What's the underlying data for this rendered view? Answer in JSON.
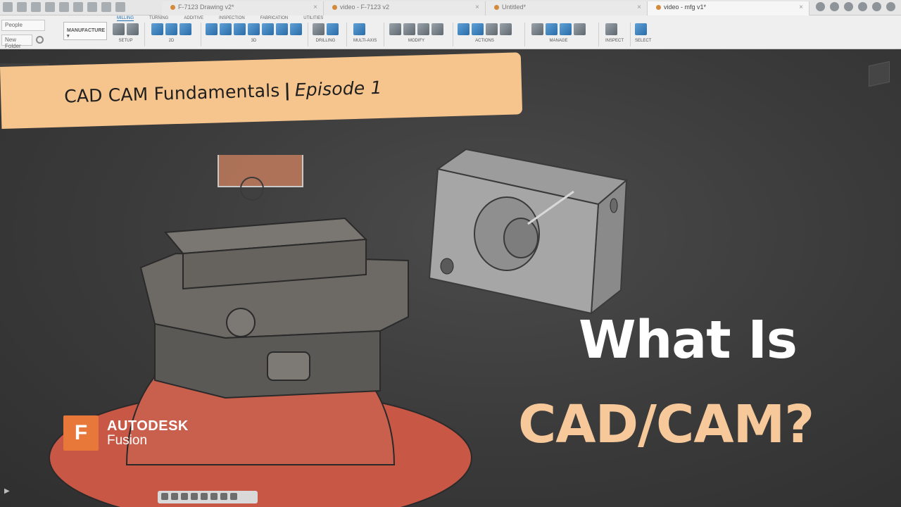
{
  "app": {
    "tabs": [
      {
        "label": "F-7123 Drawing v2*",
        "active": false
      },
      {
        "label": "video - F-7123 v2",
        "active": false
      },
      {
        "label": "Untitled*",
        "active": false
      },
      {
        "label": "video - mfg v1*",
        "active": true
      }
    ],
    "people_label": "People",
    "new_folder_label": "New Folder",
    "workspace_label": "MANUFACTURE",
    "subtabs": [
      "MILLING",
      "TURNING",
      "ADDITIVE",
      "INSPECTION",
      "FABRICATION",
      "UTILITIES"
    ],
    "groups": [
      "SETUP",
      "2D",
      "3D",
      "DRILLING",
      "MULTI-AXIS",
      "MODIFY",
      "ACTIONS",
      "MANAGE",
      "INSPECT",
      "SELECT"
    ]
  },
  "banner": {
    "series": "CAD CAM Fundamentals",
    "separator": "|",
    "episode": "Episode 1"
  },
  "headline": {
    "line1": "What Is",
    "line2": "CAD/CAM?"
  },
  "logo": {
    "letter": "F",
    "brand": "AUTODESK",
    "product": "Fusion"
  },
  "colors": {
    "banner_bg": "#f6c48d",
    "accent_text": "#f7c99a",
    "logo_orange": "#e8773a",
    "viewport_bg": "#3a3a3a"
  }
}
